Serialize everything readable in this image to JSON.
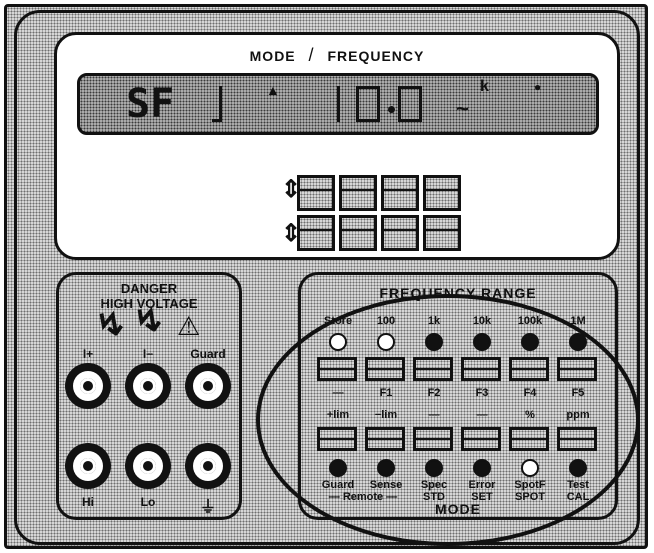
{
  "display": {
    "title_left": "MODE",
    "title_sep": "/",
    "title_right": "FREQUENCY",
    "mode_readout": "SF",
    "multiplier": "k",
    "ac_symbol": "~"
  },
  "terminals": {
    "danger_line1": "DANGER",
    "danger_line2": "HIGH VOLTAGE",
    "labels_top": [
      "I+",
      "I−",
      "Guard"
    ],
    "labels_bottom": [
      "Hi",
      "Lo",
      "⏚"
    ]
  },
  "keypad": {
    "title": "FREQUENCY RANGE",
    "range_labels": [
      "Store",
      "100",
      "1k",
      "10k",
      "100k",
      "1M"
    ],
    "range_leds": [
      false,
      false,
      true,
      true,
      true,
      true
    ],
    "function_labels": [
      "—",
      "F1",
      "F2",
      "F3",
      "F4",
      "F5"
    ],
    "limit_labels": [
      "+lim",
      "−lim",
      "—",
      "—",
      "%",
      "ppm"
    ],
    "mode_leds": [
      true,
      true,
      true,
      true,
      false,
      true
    ],
    "mode_labels_top": [
      "Guard",
      "Sense",
      "Spec",
      "Error",
      "SpotF",
      "Test"
    ],
    "mode_labels_bottom": [
      "— Remote —",
      "STD",
      "SET",
      "SPOT",
      "CAL"
    ],
    "mode_title": "MODE"
  }
}
